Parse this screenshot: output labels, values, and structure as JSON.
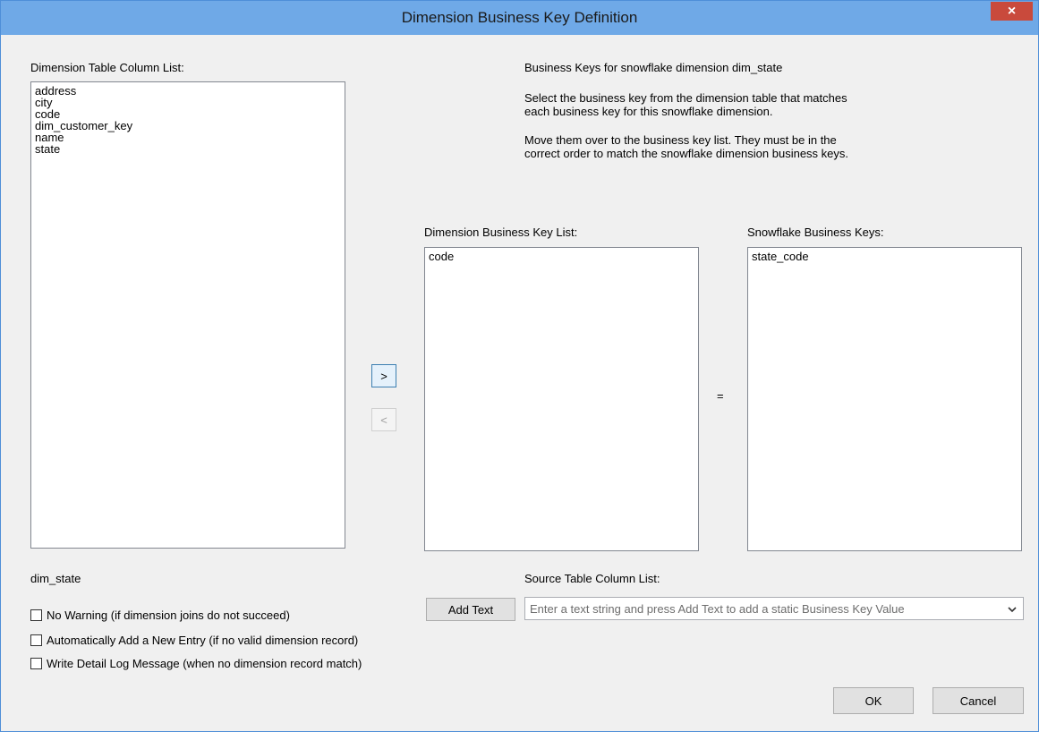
{
  "window": {
    "title": "Dimension Business Key Definition",
    "close_glyph": "×"
  },
  "left": {
    "list_label": "Dimension Table Column List:",
    "items": [
      "address",
      "city",
      "code",
      "dim_customer_key",
      "name",
      "state"
    ],
    "dimension_name": "dim_state"
  },
  "info": {
    "heading": "Business Keys for snowflake dimension dim_state",
    "para1_line1": "Select the business key from the dimension table that matches",
    "para1_line2": "each business key for this snowflake dimension.",
    "para2_line1": "Move them over to the business key list. They must be in the",
    "para2_line2": "correct order to match the snowflake dimension business keys."
  },
  "dim_keys": {
    "label": "Dimension Business Key List:",
    "items": [
      "code"
    ]
  },
  "snowflake_keys": {
    "label": "Snowflake Business Keys:",
    "items": [
      "state_code"
    ]
  },
  "controls": {
    "move_right": ">",
    "move_left": "<",
    "equals": "="
  },
  "source": {
    "label": "Source Table Column List:",
    "add_text_button": "Add Text",
    "combo_placeholder": "Enter a text string and press Add Text to add a static Business Key Value"
  },
  "options": [
    {
      "label": "No Warning (if dimension joins do not succeed)",
      "checked": false
    },
    {
      "label": "Automatically Add a New Entry (if no valid dimension record)",
      "checked": false
    },
    {
      "label": "Write Detail Log Message (when no dimension record match)",
      "checked": false
    }
  ],
  "footer": {
    "ok": "OK",
    "cancel": "Cancel"
  },
  "colors": {
    "titlebar": "#6fa9e7",
    "close_button": "#c94a3c",
    "dialog_bg": "#f0f0f0"
  }
}
